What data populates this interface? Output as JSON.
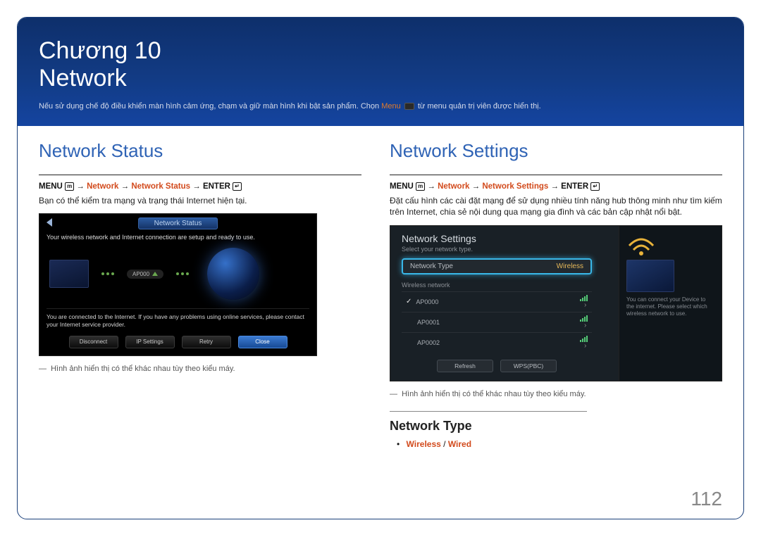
{
  "header": {
    "chapter_line": "Chương 10",
    "title": "Network",
    "note_before": "Nếu sử dụng chế độ điều khiển màn hình cảm ứng, chạm và giữ màn hình khi bật sản phẩm. Chọn ",
    "note_menu": "Menu",
    "note_after": " từ menu quản trị viên được hiển thị."
  },
  "left": {
    "title": "Network Status",
    "path": {
      "p1": "MENU ",
      "p2": " → ",
      "p3": "Network",
      "p4": " → ",
      "p5": "Network Status",
      "p6": " → ",
      "p7": "ENTER "
    },
    "desc": "Bạn có thể kiểm tra mạng và trạng thái Internet hiện tại.",
    "shot": {
      "tab": "Network Status",
      "msg1": "Your wireless network and Internet connection are setup and ready to use.",
      "ap": "AP000",
      "msg2": "You are connected to the Internet. If you have any problems using online services, please contact your Internet service provider.",
      "btn1": "Disconnect",
      "btn2": "IP Settings",
      "btn3": "Retry",
      "btn4": "Close"
    },
    "caption": "Hình ảnh hiển thị có thể khác nhau tùy theo kiểu máy."
  },
  "right": {
    "title": "Network Settings",
    "path": {
      "p1": "MENU ",
      "p2": " → ",
      "p3": "Network",
      "p4": " → ",
      "p5": "Network Settings",
      "p6": " → ",
      "p7": "ENTER "
    },
    "desc": "Đặt cấu hình các cài đặt mạng để sử dụng nhiều tính năng hub thông minh như tìm kiếm trên Internet, chia sẻ nội dung qua mạng gia đình và các bản cập nhật nổi bật.",
    "shot": {
      "title": "Network Settings",
      "subtitle": "Select your network type.",
      "type_label": "Network Type",
      "type_value": "Wireless",
      "list_label": "Wireless network",
      "ap1": "AP0000",
      "ap2": "AP0001",
      "ap3": "AP0002",
      "btn_refresh": "Refresh",
      "btn_wps": "WPS(PBC)",
      "side_text": "You can connect your Device to the internet. Please select which wireless network to use."
    },
    "caption": "Hình ảnh hiển thị có thể khác nhau tùy theo kiểu máy.",
    "subsection": {
      "title": "Network Type",
      "opt1": "Wireless",
      "sep": " / ",
      "opt2": "Wired"
    }
  },
  "page_number": "112"
}
